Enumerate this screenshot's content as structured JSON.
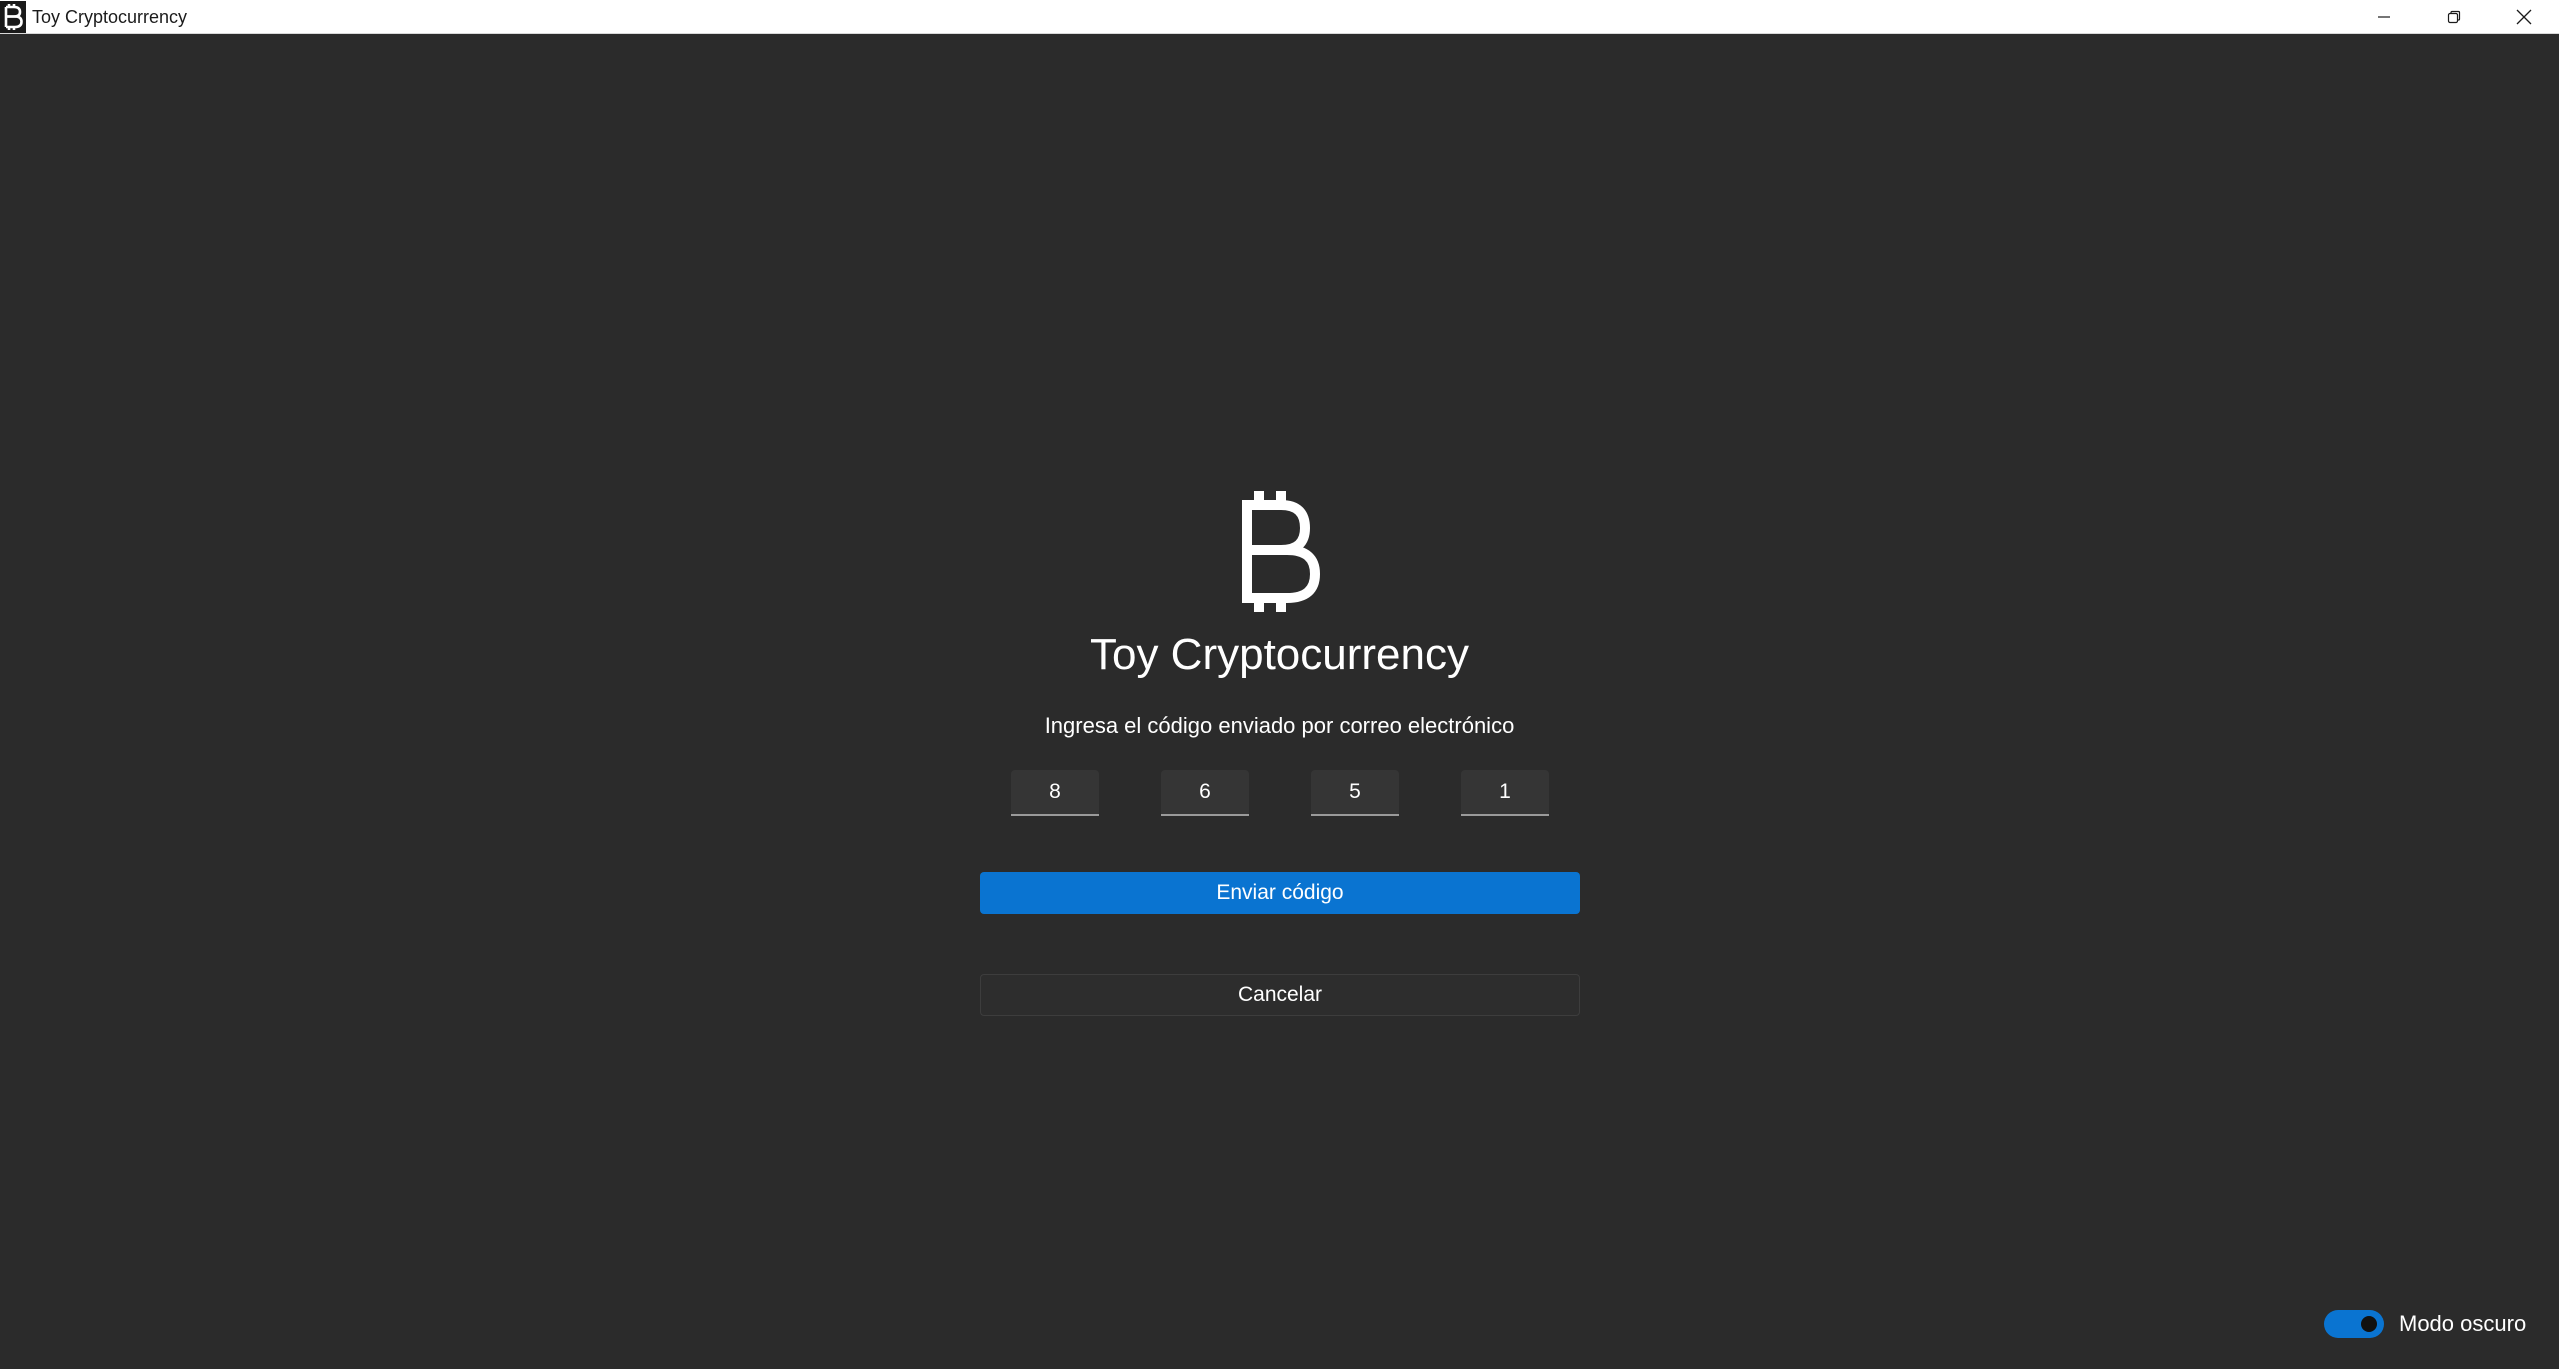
{
  "window": {
    "title": "Toy Cryptocurrency",
    "controls": [
      "minimize",
      "restore",
      "close"
    ]
  },
  "login": {
    "logo_icon": "bitcoin-icon",
    "app_name": "Toy Cryptocurrency",
    "prompt": "Ingresa el código enviado por correo electrónico",
    "code_digits": [
      "8",
      "6",
      "5",
      "1"
    ],
    "submit_label": "Enviar código",
    "cancel_label": "Cancelar"
  },
  "footer": {
    "dark_mode_label": "Modo oscuro",
    "dark_mode_on": true
  },
  "colors": {
    "background": "#2b2b2b",
    "accent": "#0a74d1",
    "titlebar": "#ffffff"
  }
}
